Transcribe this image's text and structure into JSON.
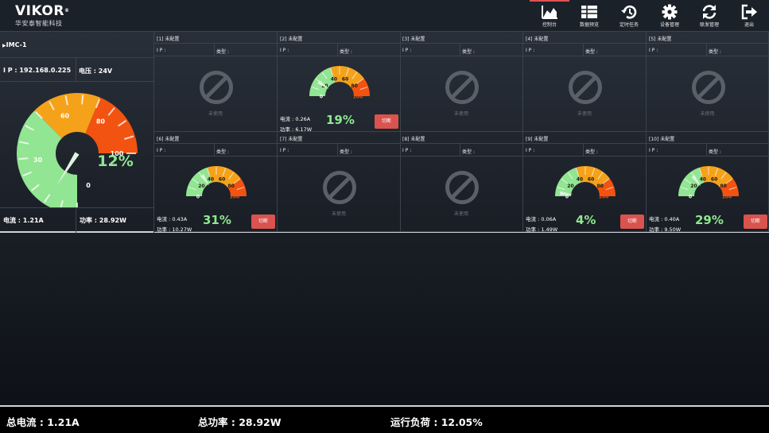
{
  "header": {
    "logo": "VIKOR",
    "logo_mark": "®",
    "logo_sub": "华安泰智能科技",
    "nav": [
      {
        "label": "控制台",
        "icon": "area-chart-icon",
        "active": true
      },
      {
        "label": "数据预览",
        "icon": "table-icon",
        "active": false
      },
      {
        "label": "定时任务",
        "icon": "history-icon",
        "active": false
      },
      {
        "label": "设备管理",
        "icon": "gear-icon",
        "active": false
      },
      {
        "label": "联发管理",
        "icon": "refresh-icon",
        "active": false
      },
      {
        "label": "退出",
        "icon": "logout-icon",
        "active": false
      }
    ]
  },
  "device": {
    "name": "IMC-1",
    "ip": "I P : 192.168.0.225",
    "voltage": "电压 : 24V",
    "current": "电流 : 1.21A",
    "power": "功率 : 28.92W",
    "load_percent": "12%",
    "load_value": 12,
    "ticks": [
      "0",
      "30",
      "60",
      "80",
      "100"
    ]
  },
  "gauge_scale": [
    "0",
    "20",
    "40",
    "60",
    "80",
    "100"
  ],
  "colors": {
    "green": "#92e592",
    "orange": "#f5a21b",
    "red": "#f25311",
    "cut": "#d9534f"
  },
  "channels": [
    {
      "head": "[1] 未配置",
      "ip": "I P :",
      "type": "类型 :",
      "used": false,
      "unused": "未使用"
    },
    {
      "head": "[2] 未配置",
      "ip": "I P :",
      "type": "类型 :",
      "used": true,
      "current": "电流 : 0.26A",
      "power": "功率 : 6.17W",
      "pct": "19%",
      "value": 19,
      "cut": "切断"
    },
    {
      "head": "[3] 未配置",
      "ip": "I P :",
      "type": "类型 :",
      "used": false,
      "unused": "未使用"
    },
    {
      "head": "[4] 未配置",
      "ip": "I P :",
      "type": "类型 :",
      "used": false,
      "unused": "未使用"
    },
    {
      "head": "[5] 未配置",
      "ip": "I P :",
      "type": "类型 :",
      "used": false,
      "unused": "未使用"
    },
    {
      "head": "[6] 未配置",
      "ip": "I P :",
      "type": "类型 :",
      "used": true,
      "current": "电流 : 0.43A",
      "power": "功率 : 10.27W",
      "pct": "31%",
      "value": 31,
      "cut": "切断"
    },
    {
      "head": "[7] 未配置",
      "ip": "I P :",
      "type": "类型 :",
      "used": false,
      "unused": "未使用"
    },
    {
      "head": "[8] 未配置",
      "ip": "I P :",
      "type": "类型 :",
      "used": false,
      "unused": "未使用"
    },
    {
      "head": "[9] 未配置",
      "ip": "I P :",
      "type": "类型 :",
      "used": true,
      "current": "电流 : 0.06A",
      "power": "功率 : 1.49W",
      "pct": "4%",
      "value": 4,
      "cut": "切断"
    },
    {
      "head": "[10] 未配置",
      "ip": "I P :",
      "type": "类型 :",
      "used": true,
      "current": "电流 : 0.40A",
      "power": "功率 : 9.50W",
      "pct": "29%",
      "value": 29,
      "cut": "切断"
    }
  ],
  "footer": {
    "total_current": "总电流 : 1.21A",
    "total_power": "总功率 : 28.92W",
    "run_load": "运行负荷 : 12.05%"
  }
}
